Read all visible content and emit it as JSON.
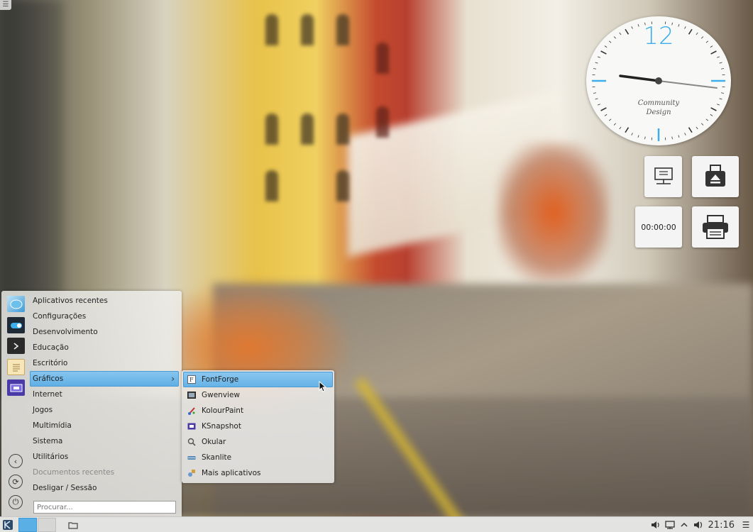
{
  "toolbox": {
    "icon": "hamburger-icon",
    "glyph": "☰"
  },
  "clock_widget": {
    "twelve": "12",
    "brand_line1": "Community",
    "brand_line2": "Design",
    "hour_angle": -92,
    "minute_angle": 96
  },
  "desktop_widgets": {
    "timer": "00:00:00",
    "icons": [
      "network-monitor-icon",
      "device-eject-icon",
      "printer-icon"
    ]
  },
  "launcher": {
    "categories": [
      {
        "label": "Aplicativos recentes"
      },
      {
        "label": "Configurações"
      },
      {
        "label": "Desenvolvimento"
      },
      {
        "label": "Educação"
      },
      {
        "label": "Escritório"
      },
      {
        "label": "Gráficos",
        "arrow": "›"
      },
      {
        "label": "Internet"
      },
      {
        "label": "Jogos"
      },
      {
        "label": "Multimídia"
      },
      {
        "label": "Sistema"
      },
      {
        "label": "Utilitários"
      },
      {
        "label": "Documentos recentes"
      },
      {
        "label": "Desligar / Sessão"
      }
    ],
    "search_placeholder": "Procurar...",
    "sidebar_buttons": {
      "back": "‹",
      "switch": "⟳",
      "power": "⏻"
    }
  },
  "submenu": {
    "items": [
      {
        "label": "FontForge"
      },
      {
        "label": "Gwenview"
      },
      {
        "label": "KolourPaint"
      },
      {
        "label": "KSnapshot"
      },
      {
        "label": "Okular"
      },
      {
        "label": "Skanlite"
      },
      {
        "label": "Mais aplicativos"
      }
    ]
  },
  "taskbar": {
    "time": "21:16",
    "tray_glyphs": {
      "volume": "🔈",
      "notifications": "^",
      "menu": "☰"
    }
  },
  "colors": {
    "accent": "#3daee9",
    "highlight": "#6ab4e8",
    "panel": "#e3e3e1"
  }
}
